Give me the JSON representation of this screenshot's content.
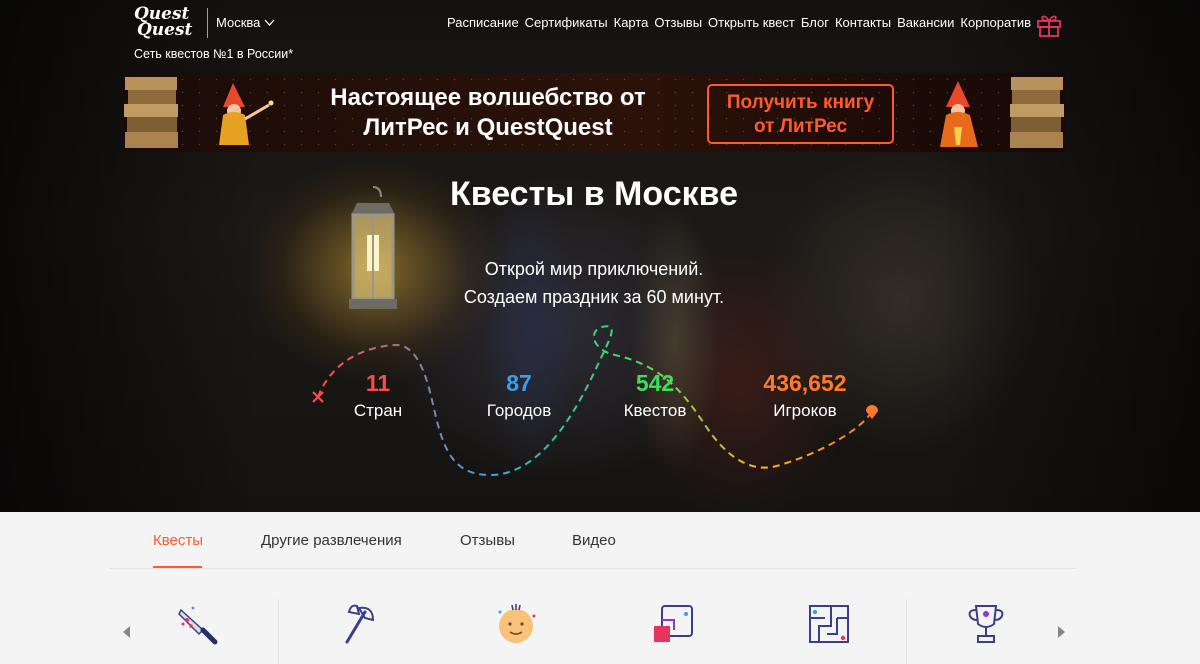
{
  "header": {
    "logo_line1": "Quest",
    "logo_line2": "Quest",
    "city": "Москва",
    "tagline": "Сеть квестов №1 в России*",
    "nav": [
      "Расписание",
      "Сертификаты",
      "Карта",
      "Отзывы",
      "Открыть квест",
      "Блог",
      "Контакты",
      "Вакансии",
      "Корпоратив"
    ]
  },
  "banner": {
    "line1": "Настоящее волшебство от",
    "line2": "ЛитРес и QuestQuest",
    "button_line1": "Получить книгу",
    "button_line2": "от ЛитРес"
  },
  "hero": {
    "title": "Квесты в Москве",
    "subtitle1": "Открой мир приключений.",
    "subtitle2": "Создаем праздник за 60 минут."
  },
  "stats": [
    {
      "value": "11",
      "label": "Стран",
      "color": "#ff4a4a"
    },
    {
      "value": "87",
      "label": "Городов",
      "color": "#3aa0e8"
    },
    {
      "value": "542",
      "label": "Квестов",
      "color": "#3adf5a"
    },
    {
      "value": "436,652",
      "label": "Игроков",
      "color": "#ff7a2a"
    }
  ],
  "tabs": [
    "Квесты",
    "Другие развлечения",
    "Отзывы",
    "Видео"
  ],
  "categories": [
    "knife-icon",
    "axe-icon",
    "kid-face-icon",
    "puzzle-icon",
    "maze-icon",
    "trophy-icon"
  ],
  "colors": {
    "accent": "#ff5a2a"
  }
}
